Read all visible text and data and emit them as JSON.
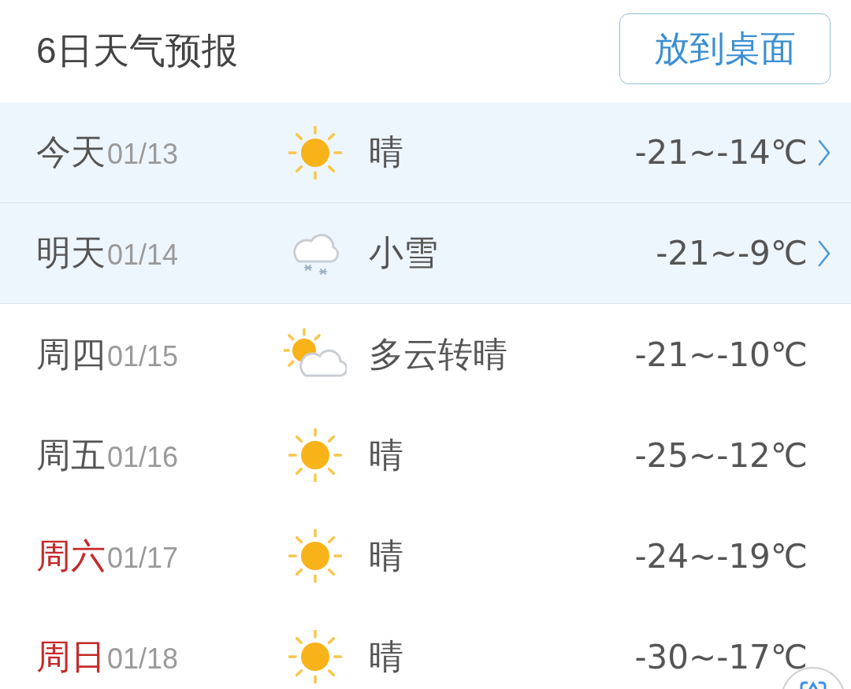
{
  "header": {
    "title": "6日天气预报",
    "button": "放到桌面"
  },
  "days": [
    {
      "day": "今天",
      "date": "01/13",
      "kind": "sunny",
      "condition": "晴",
      "temperature": "-21~-14℃",
      "weekend": false,
      "highlighted": true,
      "has_details": true
    },
    {
      "day": "明天",
      "date": "01/14",
      "kind": "snow",
      "condition": "小雪",
      "temperature": "-21~-9℃",
      "weekend": false,
      "highlighted": true,
      "has_details": true
    },
    {
      "day": "周四",
      "date": "01/15",
      "kind": "cloudy",
      "condition": "多云转晴",
      "temperature": "-21~-10℃",
      "weekend": false,
      "highlighted": false,
      "has_details": false
    },
    {
      "day": "周五",
      "date": "01/16",
      "kind": "sunny",
      "condition": "晴",
      "temperature": "-25~-12℃",
      "weekend": false,
      "highlighted": false,
      "has_details": false
    },
    {
      "day": "周六",
      "date": "01/17",
      "kind": "sunny",
      "condition": "晴",
      "temperature": "-24~-19℃",
      "weekend": true,
      "highlighted": false,
      "has_details": false
    },
    {
      "day": "周日",
      "date": "01/18",
      "kind": "sunny",
      "condition": "晴",
      "temperature": "-30~-17℃",
      "weekend": true,
      "highlighted": false,
      "has_details": false
    }
  ]
}
